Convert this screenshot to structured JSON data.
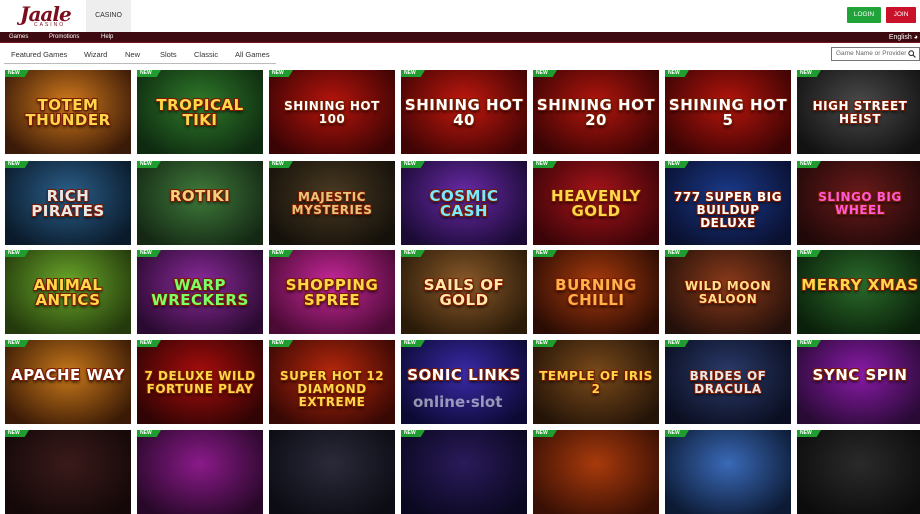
{
  "header": {
    "logo_text": "Jaale",
    "logo_sub": "CASINO",
    "tab_casino": "CASINO",
    "login_label": "LOGIN",
    "join_label": "JOIN"
  },
  "menu": {
    "items": [
      "Games",
      "Promotions",
      "Help"
    ],
    "language": "English"
  },
  "categories": [
    "Featured Games",
    "Wizard",
    "New",
    "Slots",
    "Classic",
    "All Games"
  ],
  "search": {
    "placeholder": "Game Name or Provider"
  },
  "badge_label": "NEW",
  "watermark": "online·slot",
  "games": [
    {
      "title": "TOTEM THUNDER",
      "badge": true,
      "bg": "#d27a1c",
      "bg2": "#3a1a08",
      "color": "#ffd84a"
    },
    {
      "title": "TROPICAL TIKI",
      "badge": true,
      "bg": "#2f7a2a",
      "bg2": "#0e2a10",
      "color": "#ffd84a"
    },
    {
      "title": "SHINING HOT 100",
      "badge": true,
      "bg": "#b8140c",
      "bg2": "#3a0404",
      "color": "#ffffff"
    },
    {
      "title": "SHINING HOT 40",
      "badge": true,
      "bg": "#c2180e",
      "bg2": "#400404",
      "color": "#ffffff"
    },
    {
      "title": "SHINING HOT 20",
      "badge": true,
      "bg": "#b3150d",
      "bg2": "#3a0404",
      "color": "#ffffff"
    },
    {
      "title": "SHINING HOT 5",
      "badge": true,
      "bg": "#b6140c",
      "bg2": "#3a0404",
      "color": "#ffffff"
    },
    {
      "title": "HIGH STREET HEIST",
      "badge": true,
      "bg": "#4a4a4a",
      "bg2": "#121212",
      "color": "#ffffff"
    },
    {
      "title": "RICH PIRATES",
      "badge": true,
      "bg": "#2b5f8a",
      "bg2": "#0a1a2a",
      "color": "#e8e8e8"
    },
    {
      "title": "ROTIKI",
      "badge": true,
      "bg": "#3f7a3a",
      "bg2": "#142814",
      "color": "#f2d27a"
    },
    {
      "title": "MAJESTIC MYSTERIES",
      "badge": true,
      "bg": "#4a3a22",
      "bg2": "#14100a",
      "color": "#e6c47a"
    },
    {
      "title": "COSMIC CASH",
      "badge": true,
      "bg": "#6a2aa8",
      "bg2": "#1a0a34",
      "color": "#7ae8ff"
    },
    {
      "title": "HEAVENLY GOLD",
      "badge": true,
      "bg": "#a8141a",
      "bg2": "#3a0408",
      "color": "#ffd84a"
    },
    {
      "title": "777 SUPER BIG BUILDUP DELUXE",
      "badge": true,
      "bg": "#1a3a8a",
      "bg2": "#0a1030",
      "color": "#ffffff"
    },
    {
      "title": "SLINGO BIG WHEEL",
      "badge": true,
      "bg": "#6a1a1a",
      "bg2": "#200808",
      "color": "#ff5ad8"
    },
    {
      "title": "ANIMAL ANTICS",
      "badge": true,
      "bg": "#6aa82a",
      "bg2": "#243a0c",
      "color": "#ffd84a"
    },
    {
      "title": "WARP WRECKERS",
      "badge": true,
      "bg": "#8a2a9a",
      "bg2": "#2a0a30",
      "color": "#7aff6a"
    },
    {
      "title": "SHOPPING SPREE",
      "badge": true,
      "bg": "#c8289a",
      "bg2": "#4a0a34",
      "color": "#ffd84a"
    },
    {
      "title": "SAILS OF GOLD",
      "badge": true,
      "bg": "#8a5a2a",
      "bg2": "#2a1a08",
      "color": "#ffe8a8"
    },
    {
      "title": "BURNING CHILLI",
      "badge": true,
      "bg": "#a83a0c",
      "bg2": "#2a0c04",
      "color": "#ffb24a"
    },
    {
      "title": "WILD MOON SALOON",
      "badge": true,
      "bg": "#8a3a1a",
      "bg2": "#24100a",
      "color": "#ffe08a"
    },
    {
      "title": "MERRY XMAS",
      "badge": true,
      "bg": "#2a6a2a",
      "bg2": "#0a200a",
      "color": "#ffd84a"
    },
    {
      "title": "APACHE WAY",
      "badge": true,
      "bg": "#c8781a",
      "bg2": "#3a1a06",
      "color": "#ffffff"
    },
    {
      "title": "7 DELUXE WILD FORTUNE PLAY",
      "badge": true,
      "bg": "#a80c0c",
      "bg2": "#300404",
      "color": "#ffd84a"
    },
    {
      "title": "SUPER HOT 12 DIAMOND EXTREME",
      "badge": true,
      "bg": "#b8280c",
      "bg2": "#380804",
      "color": "#ffd84a"
    },
    {
      "title": "SONIC LINKS",
      "badge": true,
      "bg": "#3a2aa8",
      "bg2": "#0c0a34",
      "color": "#ffffff"
    },
    {
      "title": "TEMPLE OF IRIS 2",
      "badge": true,
      "bg": "#7a4a1a",
      "bg2": "#241408",
      "color": "#ffd84a"
    },
    {
      "title": "BRIDES OF DRACULA",
      "badge": true,
      "bg": "#2a3a6a",
      "bg2": "#0a0e20",
      "color": "#e8e8e8"
    },
    {
      "title": "SYNC SPIN",
      "badge": true,
      "bg": "#8a1aa8",
      "bg2": "#280a34",
      "color": "#ffffff"
    },
    {
      "title": "",
      "badge": true,
      "bg": "#3a1a1a",
      "bg2": "#140808",
      "color": "#ffffff"
    },
    {
      "title": "",
      "badge": true,
      "bg": "#8a1a8a",
      "bg2": "#280828",
      "color": "#ffffff"
    },
    {
      "title": "",
      "badge": false,
      "bg": "#2a2a3a",
      "bg2": "#0c0c14",
      "color": "#ffffff"
    },
    {
      "title": "",
      "badge": true,
      "bg": "#2a1a5a",
      "bg2": "#0a0820",
      "color": "#ffffff"
    },
    {
      "title": "",
      "badge": true,
      "bg": "#a83a0c",
      "bg2": "#3a1004",
      "color": "#ffffff"
    },
    {
      "title": "",
      "badge": true,
      "bg": "#3a6ab8",
      "bg2": "#0c1a34",
      "color": "#ffffff"
    },
    {
      "title": "",
      "badge": true,
      "bg": "#2a2a2a",
      "bg2": "#0c0c0c",
      "color": "#ffffff"
    }
  ]
}
